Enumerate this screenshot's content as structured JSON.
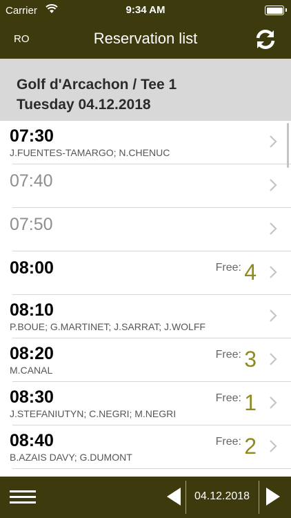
{
  "status_bar": {
    "carrier": "Carrier",
    "time": "9:34 AM"
  },
  "nav": {
    "left_label": "RO",
    "title": "Reservation list",
    "refresh_icon": "refresh-icon"
  },
  "header": {
    "course": "Golf d'Arcachon / Tee 1",
    "date_line": "Tuesday 04.12.2018"
  },
  "reservations": [
    {
      "time": "07:30",
      "players": "J.FUENTES-TAMARGO; N.CHENUC",
      "free_label": "",
      "free_count": "",
      "past": false
    },
    {
      "time": "07:40",
      "players": "",
      "free_label": "",
      "free_count": "",
      "past": true
    },
    {
      "time": "07:50",
      "players": "",
      "free_label": "",
      "free_count": "",
      "past": true
    },
    {
      "time": "08:00",
      "players": "",
      "free_label": "Free:",
      "free_count": "4",
      "past": false
    },
    {
      "time": "08:10",
      "players": "P.BOUE; G.MARTINET; J.SARRAT; J.WOLFF",
      "free_label": "",
      "free_count": "",
      "past": false
    },
    {
      "time": "08:20",
      "players": "M.CANAL",
      "free_label": "Free:",
      "free_count": "3",
      "past": false
    },
    {
      "time": "08:30",
      "players": "J.STEFANIUTYN; C.NEGRI; M.NEGRI",
      "free_label": "Free:",
      "free_count": "1",
      "past": false
    },
    {
      "time": "08:40",
      "players": "B.AZAIS DAVY; G.DUMONT",
      "free_label": "Free:",
      "free_count": "2",
      "past": false
    }
  ],
  "footer": {
    "menu_icon": "hamburger-menu-icon",
    "date": "04.12.2018"
  },
  "colors": {
    "bar": "#3d3b0e",
    "accent": "#8f8a22",
    "header_bg": "#d8d8d8"
  }
}
